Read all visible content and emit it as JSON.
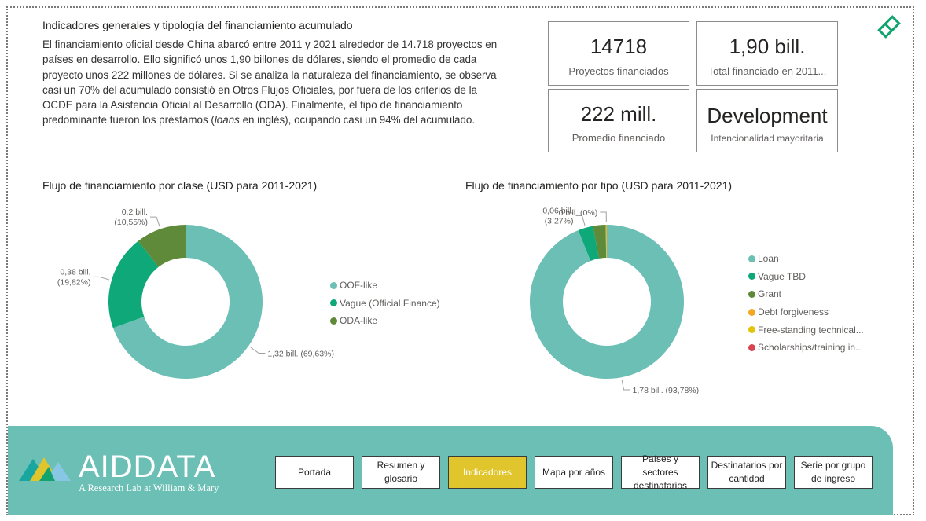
{
  "intro": {
    "title": "Indicadores generales y tipología del financiamiento acumulado",
    "body_pre": "El financiamiento oficial desde China abarcó entre 2011 y 2021 alrededor de 14.718 proyectos en países en desarrollo. Ello significó unos 1,90 billones de dólares, siendo el promedio de cada proyecto unos 222 millones de dólares. Si se analiza la naturaleza del financiamiento, se observa casi un 70% del acumulado consistió en Otros Flujos Oficiales, por fuera de los criterios de la OCDE para la Asistencia Oficial al Desarrollo (ODA). Finalmente, el tipo de financiamiento predominante fueron los préstamos (",
    "body_em": "loans",
    "body_post": " en inglés), ocupando casi un 94% del acumulado."
  },
  "kpis": [
    {
      "value": "14718",
      "label": "Proyectos financiados"
    },
    {
      "value": "1,90 bill.",
      "label": "Total financiado en 2011..."
    },
    {
      "value": "222 mill.",
      "label": "Promedio financiado"
    },
    {
      "value": "Development",
      "label": "Intencionalidad mayoritaria"
    }
  ],
  "colors": {
    "teal": "#6bbfb5",
    "green": "#0fa878",
    "olive": "#5e8a3a",
    "orange": "#f5a623",
    "yellow": "#e4c40a",
    "red": "#d64550",
    "active_button": "#e0c52d",
    "diamond_icon": "#12a36f"
  },
  "chart_data": [
    {
      "type": "pie",
      "title": "Flujo de financiamiento por clase (USD para 2011-2021)",
      "categories": [
        "OOF-like",
        "Vague (Official Finance)",
        "ODA-like"
      ],
      "values": [
        1.32,
        0.38,
        0.2
      ],
      "percent": [
        69.63,
        19.82,
        10.55
      ],
      "colors": [
        "#6bbfb5",
        "#0fa878",
        "#5e8a3a"
      ],
      "data_labels": [
        "1,32 bill. (69,63%)",
        "0,38 bill. (19,82%)",
        "0,2 bill. (10,55%)"
      ],
      "unit": "USD",
      "legend_position": "right"
    },
    {
      "type": "pie",
      "title": "Flujo de financiamiento por tipo (USD para 2011-2021)",
      "categories": [
        "Loan",
        "Vague TBD",
        "Grant",
        "Debt forgiveness",
        "Free-standing technical...",
        "Scholarships/training in..."
      ],
      "values": [
        1.78,
        0.06,
        0.05,
        0.001,
        0.003,
        0.0005
      ],
      "percent": [
        93.78,
        3.27,
        2.6,
        0.05,
        0.15,
        0.02
      ],
      "colors": [
        "#6bbfb5",
        "#0fa878",
        "#5e8a3a",
        "#f5a623",
        "#e4c40a",
        "#d64550"
      ],
      "data_labels": [
        "1,78 bill. (93,78%)",
        "0,06 bill. (3,27%)",
        "",
        "",
        "0 bill. (0%)",
        ""
      ],
      "unit": "USD",
      "legend_position": "right"
    }
  ],
  "logo": {
    "name": "AIDDATA",
    "tagline": "A Research Lab at William & Mary"
  },
  "nav": [
    {
      "label": "Portada",
      "active": false
    },
    {
      "label": "Resumen y glosario",
      "active": false
    },
    {
      "label": "Indicadores",
      "active": true
    },
    {
      "label": "Mapa por años",
      "active": false
    },
    {
      "label": "Países y sectores destinatarios",
      "active": false
    },
    {
      "label": "Destinatarios por cantidad",
      "active": false
    },
    {
      "label": "Serie por grupo de ingreso",
      "active": false
    }
  ]
}
